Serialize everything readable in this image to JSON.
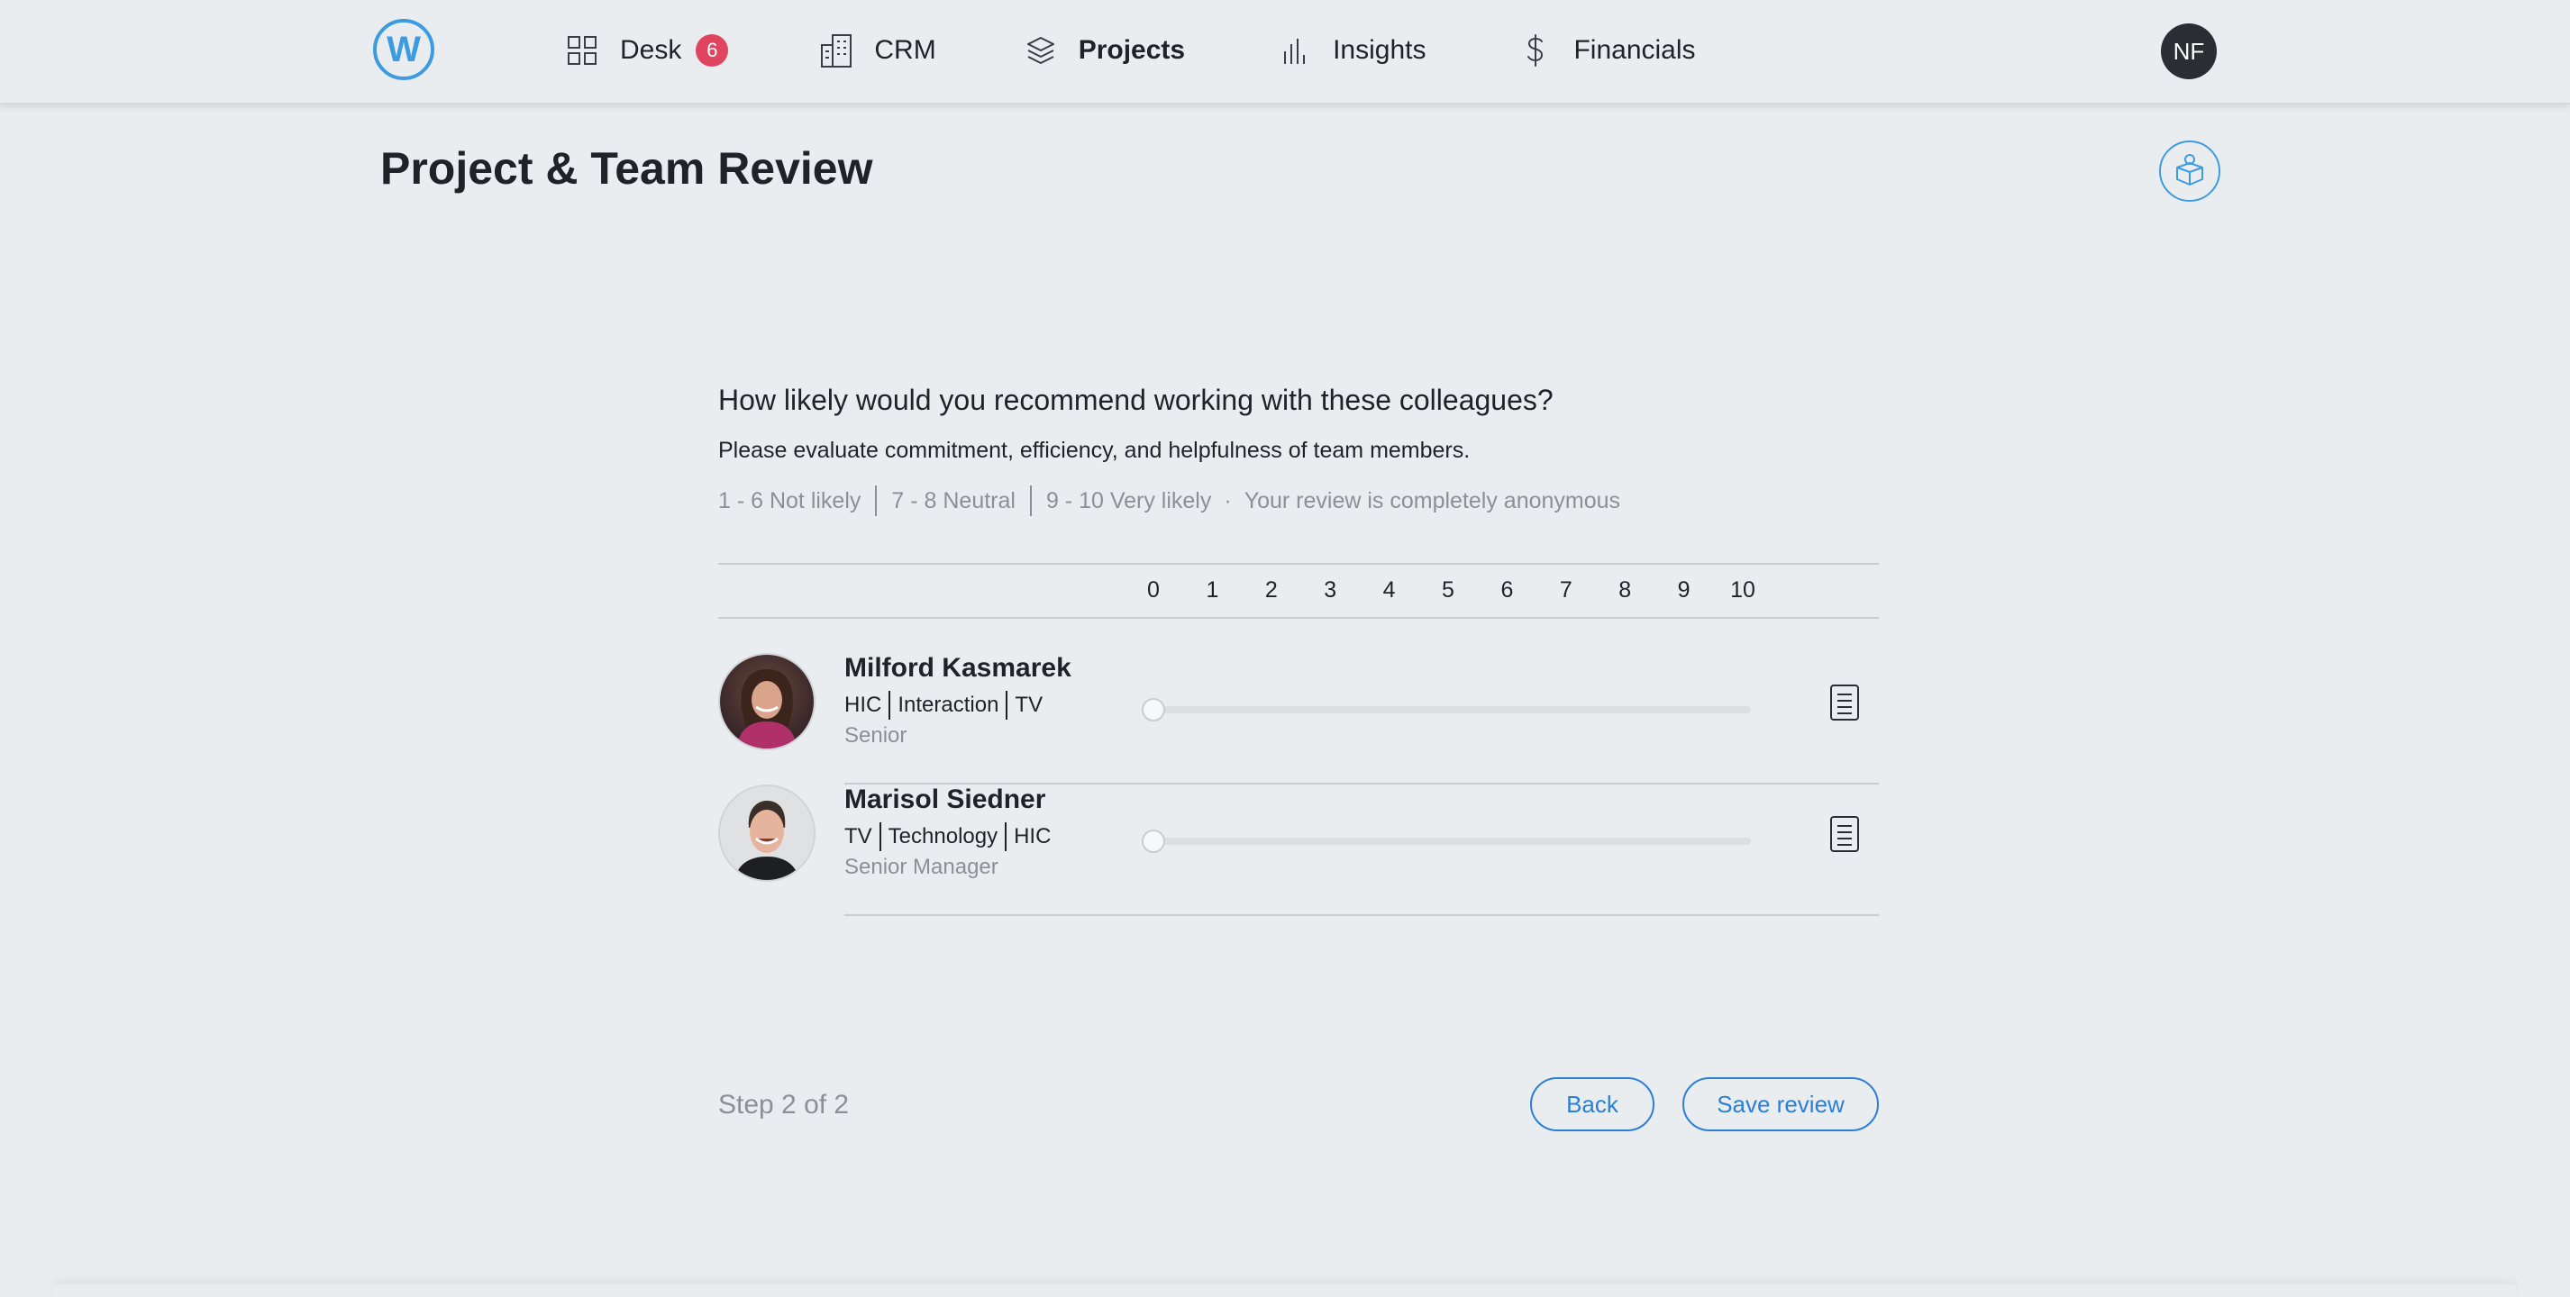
{
  "nav": {
    "logo_letter": "W",
    "items": [
      {
        "label": "Desk",
        "icon": "grid-icon",
        "badge": "6"
      },
      {
        "label": "CRM",
        "icon": "building-icon"
      },
      {
        "label": "Projects",
        "icon": "layers-icon",
        "active": true
      },
      {
        "label": "Insights",
        "icon": "bar-chart-icon"
      },
      {
        "label": "Financials",
        "icon": "dollar-icon"
      }
    ],
    "user_initials": "NF"
  },
  "page": {
    "title": "Project & Team Review",
    "help_icon": "box-person-icon"
  },
  "survey": {
    "question": "How likely would you recommend working with these colleagues?",
    "subtitle": "Please evaluate commitment, efficiency, and helpfulness of team members.",
    "legend": {
      "low": "1 - 6 Not likely",
      "mid": "7 - 8 Neutral",
      "high": "9 - 10 Very likely",
      "dot": "·",
      "anonymous": "Your review is completely anonymous"
    },
    "scale": [
      "0",
      "1",
      "2",
      "3",
      "4",
      "5",
      "6",
      "7",
      "8",
      "9",
      "10"
    ],
    "people": [
      {
        "name": "Milford Kasmarek",
        "tags": [
          "HIC",
          "Interaction",
          "TV"
        ],
        "role": "Senior",
        "rating": 0
      },
      {
        "name": "Marisol Siedner",
        "tags": [
          "TV",
          "Technology",
          "HIC"
        ],
        "role": "Senior Manager",
        "rating": 0
      }
    ]
  },
  "footer": {
    "step": "Step 2 of 2",
    "back_label": "Back",
    "save_label": "Save review"
  },
  "colors": {
    "accent": "#2b7fd4",
    "badge": "#e0455f",
    "background": "#eaedf0"
  }
}
